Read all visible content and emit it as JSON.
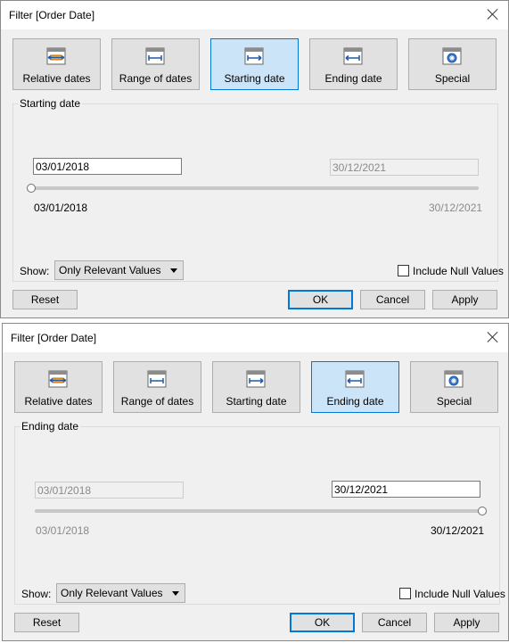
{
  "dialogs": [
    {
      "title": "Filter [Order Date]",
      "tabs": [
        {
          "label": "Relative dates",
          "icon": "relative-dates-icon"
        },
        {
          "label": "Range of dates",
          "icon": "range-of-dates-icon"
        },
        {
          "label": "Starting date",
          "icon": "starting-date-icon"
        },
        {
          "label": "Ending date",
          "icon": "ending-date-icon"
        },
        {
          "label": "Special",
          "icon": "special-icon"
        }
      ],
      "selected_tab": "Starting date",
      "group_label": "Starting date",
      "start_field": {
        "value": "03/01/2018",
        "enabled": true
      },
      "end_field": {
        "value": "30/12/2021",
        "enabled": false
      },
      "slider_position": "start",
      "range_min": "03/01/2018",
      "range_max": "30/12/2021",
      "show_label": "Show:",
      "show_value": "Only Relevant Values",
      "include_null_label": "Include Null Values",
      "include_null_checked": false,
      "buttons": {
        "reset": "Reset",
        "ok": "OK",
        "cancel": "Cancel",
        "apply": "Apply"
      }
    },
    {
      "title": "Filter [Order Date]",
      "tabs": [
        {
          "label": "Relative dates",
          "icon": "relative-dates-icon"
        },
        {
          "label": "Range of dates",
          "icon": "range-of-dates-icon"
        },
        {
          "label": "Starting date",
          "icon": "starting-date-icon"
        },
        {
          "label": "Ending date",
          "icon": "ending-date-icon"
        },
        {
          "label": "Special",
          "icon": "special-icon"
        }
      ],
      "selected_tab": "Ending date",
      "group_label": "Ending date",
      "start_field": {
        "value": "03/01/2018",
        "enabled": false
      },
      "end_field": {
        "value": "30/12/2021",
        "enabled": true
      },
      "slider_position": "end",
      "range_min": "03/01/2018",
      "range_max": "30/12/2021",
      "show_label": "Show:",
      "show_value": "Only Relevant Values",
      "include_null_label": "Include Null Values",
      "include_null_checked": false,
      "buttons": {
        "reset": "Reset",
        "ok": "OK",
        "cancel": "Cancel",
        "apply": "Apply"
      }
    }
  ],
  "colors": {
    "selected_tab": "#cce4f7",
    "selected_border": "#0078d7",
    "dialog_bg": "#f0f0f0"
  }
}
